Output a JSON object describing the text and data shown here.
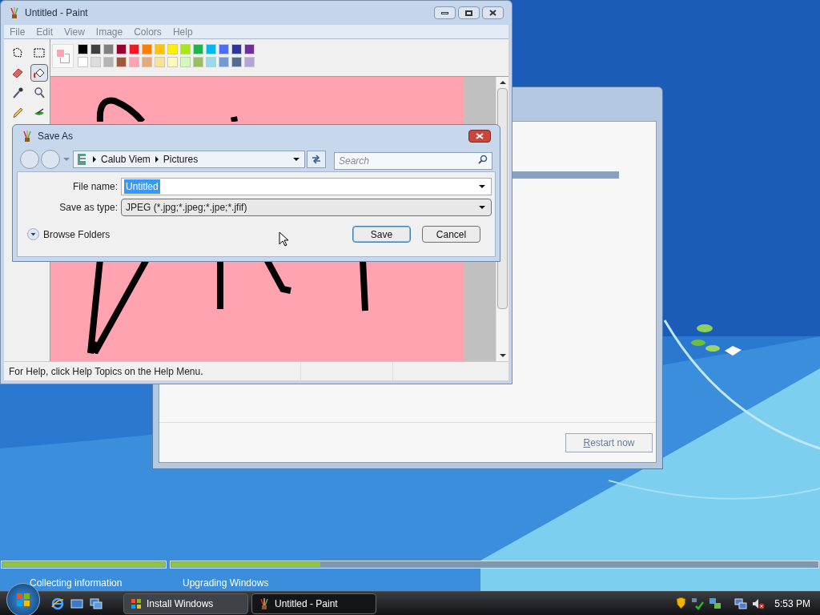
{
  "install_window": {
    "buttons": [
      {
        "label": "Restart now"
      }
    ]
  },
  "paint": {
    "title": "Untitled - Paint",
    "menu": [
      "File",
      "Edit",
      "View",
      "Image",
      "Colors",
      "Help"
    ],
    "tools": [
      {
        "kind": "free-select",
        "selected": false
      },
      {
        "kind": "rect-select",
        "selected": false
      },
      {
        "kind": "eraser",
        "selected": false
      },
      {
        "kind": "fill",
        "selected": true
      },
      {
        "kind": "picker",
        "selected": false
      },
      {
        "kind": "magnifier",
        "selected": false
      },
      {
        "kind": "pencil",
        "selected": false
      },
      {
        "kind": "brush",
        "selected": false
      }
    ],
    "current_colors": [
      {
        "kind": "background",
        "color": "#ffffff"
      },
      {
        "kind": "foreground",
        "color": "#ffa3b1"
      }
    ],
    "palette": [
      {
        "color": "#000000"
      },
      {
        "color": "#404040"
      },
      {
        "color": "#808080"
      },
      {
        "color": "#990030"
      },
      {
        "color": "#ed1c24"
      },
      {
        "color": "#ff7e00"
      },
      {
        "color": "#ffc20e"
      },
      {
        "color": "#fff200"
      },
      {
        "color": "#a8e61d"
      },
      {
        "color": "#22b14c"
      },
      {
        "color": "#00b7ef"
      },
      {
        "color": "#4d6df3"
      },
      {
        "color": "#2f3699"
      },
      {
        "color": "#6f3198"
      },
      {
        "color": "#ffffff"
      },
      {
        "color": "#dcdcdc"
      },
      {
        "color": "#b4b4b4"
      },
      {
        "color": "#9c5a3c"
      },
      {
        "color": "#ffa3b1"
      },
      {
        "color": "#e5aa7a"
      },
      {
        "color": "#f5e49c"
      },
      {
        "color": "#fff9bd"
      },
      {
        "color": "#d3f9bc"
      },
      {
        "color": "#9dbb61"
      },
      {
        "color": "#99d9ea"
      },
      {
        "color": "#709ad1"
      },
      {
        "color": "#546d8e"
      },
      {
        "color": "#b5a5d5"
      }
    ],
    "status_text": "For Help, click Help Topics on the Help Menu."
  },
  "save_as": {
    "title": "Save As",
    "path": [
      "Calub Viem",
      "Pictures"
    ],
    "search": {
      "placeholder": "Search"
    },
    "fields": [
      {
        "kind": "text",
        "label": "File name:",
        "value": "Untitled",
        "selected": true
      },
      {
        "kind": "select",
        "label": "Save as type:",
        "value": "JPEG (*.jpg;*.jpeg;*.jpe;*.jfif)",
        "selected": false
      }
    ],
    "browse_folders": "Browse Folders",
    "buttons": [
      {
        "label": "Save",
        "default": true
      },
      {
        "label": "Cancel",
        "default": false
      }
    ]
  },
  "setup_progress": [
    {
      "label": "Collecting information",
      "level": 1
    },
    {
      "label": "Upgrading Windows",
      "level": 0.23
    }
  ],
  "taskbar": {
    "tasks": [
      {
        "kind": "setup",
        "label": "Install Windows",
        "selected": false
      },
      {
        "kind": "paint",
        "label": "Untitled - Paint",
        "selected": true
      }
    ],
    "clock": "5:53 PM"
  }
}
